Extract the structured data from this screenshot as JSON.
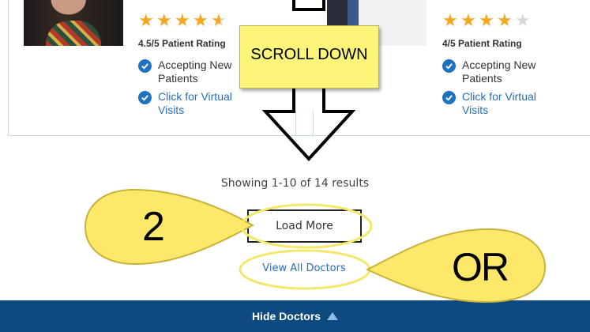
{
  "cards": [
    {
      "rating_text": "4.5/5 Patient Rating",
      "stars": [
        "full",
        "full",
        "full",
        "full",
        "half"
      ],
      "features": [
        {
          "icon": "check-circle-icon",
          "text_line1": "Accepting New",
          "text_line2": "Patients",
          "link": false
        },
        {
          "icon": "check-circle-icon",
          "text_line1": "Click for Virtual",
          "text_line2": "Visits",
          "link": true
        }
      ]
    },
    {
      "rating_text": "4/5 Patient Rating",
      "stars": [
        "full",
        "full",
        "full",
        "full",
        "empty"
      ],
      "features": [
        {
          "icon": "check-circle-icon",
          "text_line1": "Accepting New",
          "text_line2": "Patients",
          "link": false
        },
        {
          "icon": "check-circle-icon",
          "text_line1": "Click for Virtual",
          "text_line2": "Visits",
          "link": true
        }
      ]
    }
  ],
  "results": {
    "summary": "Showing 1-10 of 14 results"
  },
  "buttons": {
    "load_more": "Load More",
    "view_all": "View All Doctors"
  },
  "footer": {
    "label": "Hide Doctors",
    "icon": "triangle-up-icon"
  },
  "annotations": {
    "note": "SCROLL DOWN",
    "step_number": "2",
    "or_label": "OR"
  },
  "colors": {
    "star": "#f5a623",
    "check": "#1f72c0",
    "link": "#2a6db8",
    "footer_bg": "#0e4a80",
    "annotation_yellow": "#fde86a",
    "note_yellow": "#fdf57a"
  }
}
